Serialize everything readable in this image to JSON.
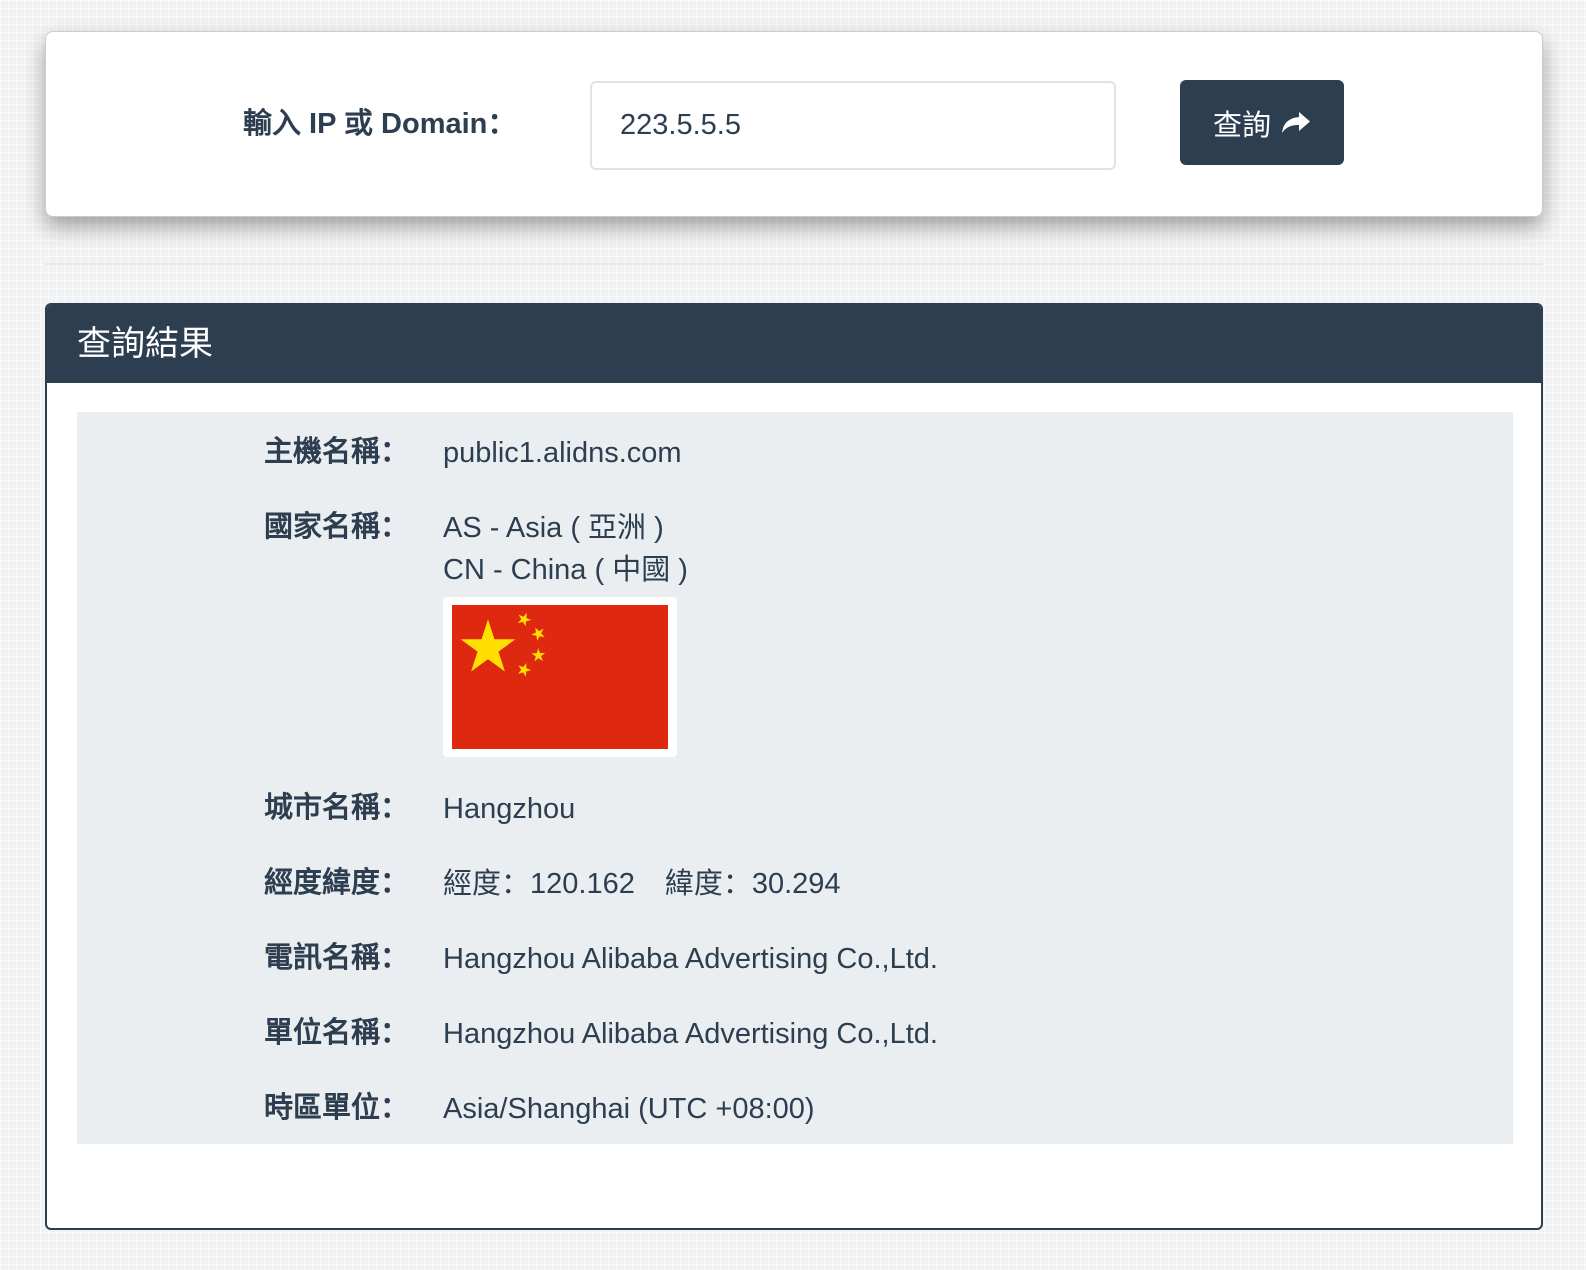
{
  "search": {
    "label": "輸入 IP 或 Domain：",
    "value": "223.5.5.5",
    "button_label": "查詢",
    "button_icon": "share-arrow-icon"
  },
  "result": {
    "title": "查詢結果",
    "hostname": {
      "label": "主機名稱：",
      "value": "public1.alidns.com"
    },
    "country": {
      "label": "國家名稱：",
      "continent": "AS - Asia ( 亞洲 )",
      "country": "CN - China ( 中國 )",
      "flag_icon": "china-flag-icon"
    },
    "city": {
      "label": "城市名稱：",
      "value": "Hangzhou"
    },
    "coordinates": {
      "label": "經度緯度：",
      "longitude": "經度：120.162",
      "latitude": "緯度：30.294"
    },
    "isp": {
      "label": "電訊名稱：",
      "value": "Hangzhou Alibaba Advertising Co.,Ltd."
    },
    "organization": {
      "label": "單位名稱：",
      "value": "Hangzhou Alibaba Advertising Co.,Ltd."
    },
    "timezone": {
      "label": "時區單位：",
      "value": "Asia/Shanghai (UTC +08:00)"
    }
  },
  "colors": {
    "primary": "#2c3e50",
    "panel_background": "#ebeef0",
    "flag_red": "#de2910",
    "flag_yellow": "#ffde00"
  }
}
